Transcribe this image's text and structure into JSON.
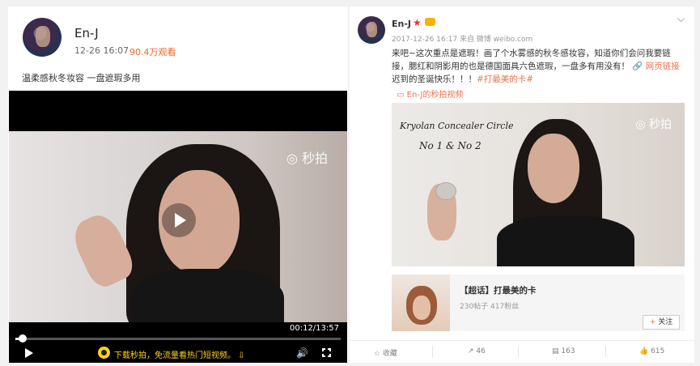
{
  "left": {
    "author": "En-J",
    "time": "12-26 16:07",
    "views": "90.4万观看",
    "description": "温柔感秋冬妆容 一盘遮瑕多用",
    "video": {
      "watermark": "◎ 秒拍",
      "current_time": "00:12/13:57",
      "progress": 0.015,
      "promo_text": "下载秒拍，免流量看热门短视频。 ⇩"
    }
  },
  "right": {
    "author": "En-J",
    "meta": "2017-12-26 16:17 来自 微博 weibo.com",
    "post_text": "来吧~这次重点是遮瑕！画了个水雾感的秋冬感妆容，知道你们会问我要链接，腮红和阴影用的也是德国面具六色遮瑕，一盘多有用没有！",
    "web_link": "🔗 网页链接",
    "line2_prefix": "迟到的圣诞快乐！！！",
    "hashtag": "#打最美的卡#",
    "video_link": "▭ En-J的秒拍视频",
    "video": {
      "handwriting_1": "Kryolan Concealer Circle",
      "handwriting_2": "No 1 & No 2",
      "watermark": "◎ 秒拍"
    },
    "topic": {
      "title": "【超话】打最美的卡",
      "stats": "230帖子 417粉丝",
      "follow": "关注",
      "follow_plus": "+"
    },
    "actions": {
      "favorite": "☆ 收藏",
      "repost": "↗ 46",
      "comment": "▤ 163",
      "like": "👍 615"
    }
  }
}
